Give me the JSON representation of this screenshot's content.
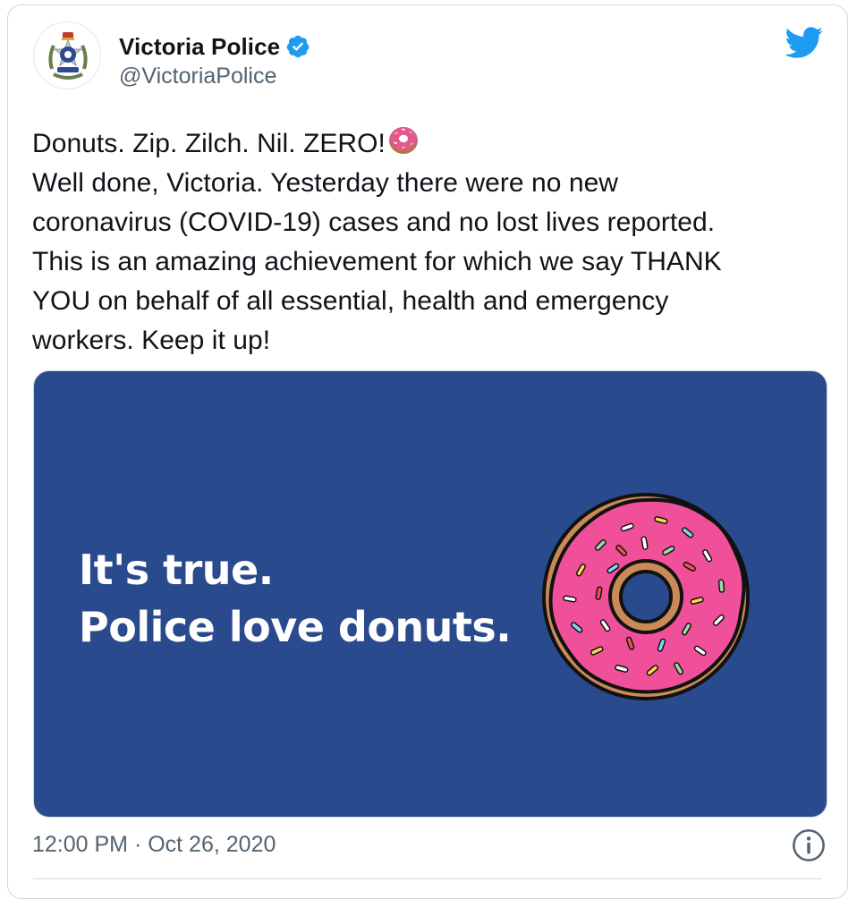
{
  "author": {
    "display_name": "Victoria Police",
    "handle": "@VictoriaPolice",
    "verified": true,
    "avatar_icon": "victoria-police-badge-icon"
  },
  "brand_icon": "twitter-bird-icon",
  "tweet": {
    "lines": [
      "Donuts. Zip. Zilch. Nil. ZERO!",
      "Well done, Victoria. Yesterday there were no new",
      "coronavirus (COVID-19) cases and no lost lives reported.",
      "This is an amazing achievement for which we say THANK",
      "YOU on behalf of all essential, health and emergency",
      "workers. Keep it up!"
    ],
    "emoji": "donut-emoji"
  },
  "media": {
    "line1": "It's true.",
    "line2": "Police love donuts.",
    "background_color": "#2a4a8e",
    "graphic": "pink-sprinkled-donut"
  },
  "footer": {
    "timestamp": "12:00 PM · Oct 26, 2020",
    "info_icon": "info-icon"
  },
  "colors": {
    "verified": "#1d9bf0",
    "twitter_blue": "#1d9bf0",
    "secondary_text": "#536471",
    "donut_frosting": "#f0509a",
    "donut_dough": "#c98a57"
  }
}
